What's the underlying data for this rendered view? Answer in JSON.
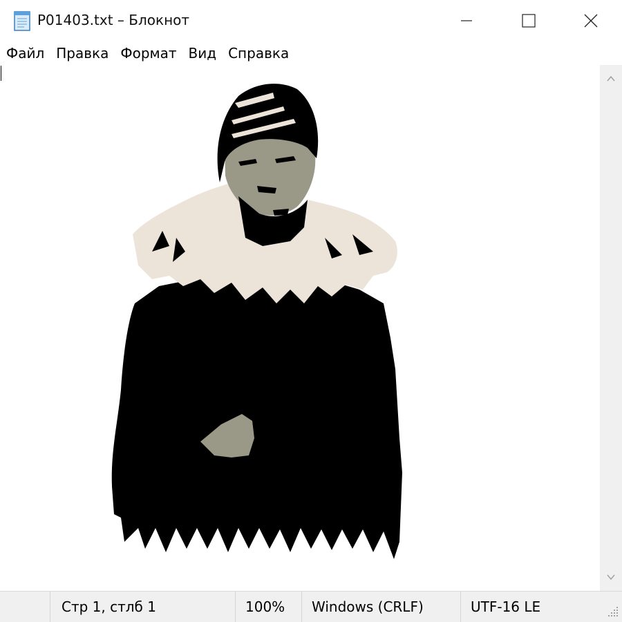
{
  "window": {
    "title": "P01403.txt – Блокнот",
    "app_icon": "notepad-icon",
    "controls": [
      "minimize-icon",
      "maximize-icon",
      "close-icon"
    ]
  },
  "menu": {
    "items": [
      "Файл",
      "Правка",
      "Формат",
      "Вид",
      "Справка"
    ]
  },
  "editor": {
    "content_description_icon": "ascii-art-portrait"
  },
  "status": {
    "position": "Стр 1, стлб 1",
    "zoom": "100%",
    "line_endings": "Windows (CRLF)",
    "encoding": "UTF-16 LE"
  },
  "colors": {
    "coat": "#000000",
    "fur": "#ece3d9",
    "skin": "#9a9886",
    "background": "#ffffff",
    "status_bar": "#f0f0f0"
  }
}
